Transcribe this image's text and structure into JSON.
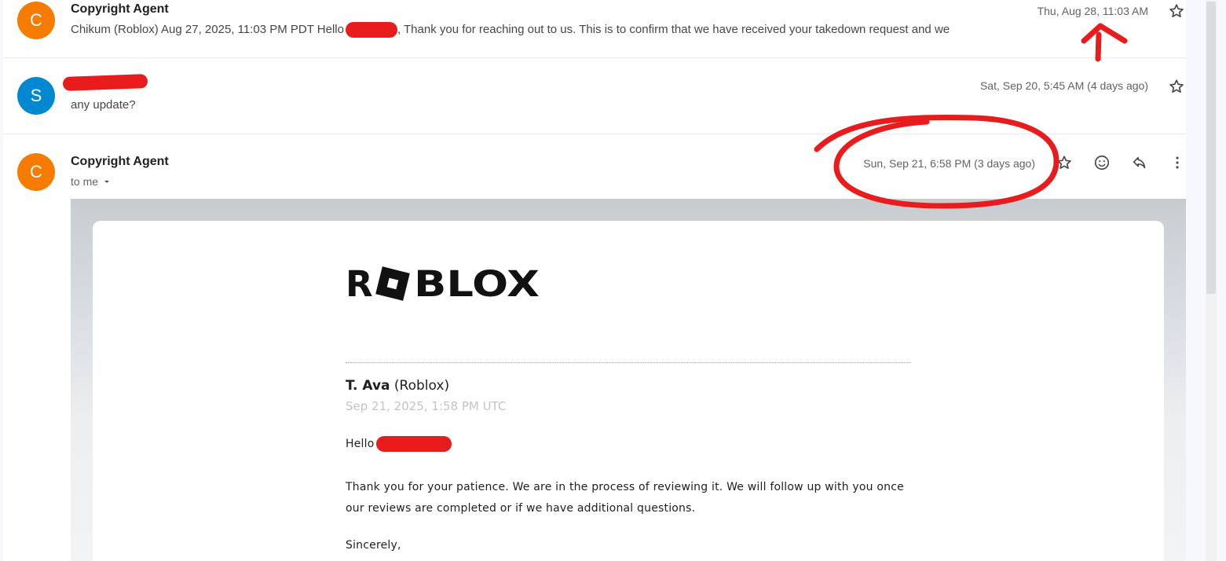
{
  "thread": [
    {
      "avatar_letter": "C",
      "avatar_color": "#f57c00",
      "sender": "Copyright Agent",
      "snippet_before": "Chikum (Roblox) Aug 27, 2025, 11:03 PM PDT Hello",
      "snippet_after": ", Thank you for reaching out to us. This is to confirm that we have received your takedown request and we",
      "date": "Thu, Aug 28, 11:03 AM"
    },
    {
      "avatar_letter": "S",
      "avatar_color": "#0288d1",
      "sender": "",
      "snippet": "any update?",
      "date": "Sat, Sep 20, 5:45 AM (4 days ago)"
    },
    {
      "avatar_letter": "C",
      "avatar_color": "#f57c00",
      "sender": "Copyright Agent",
      "recipient": "to me",
      "date": "Sun, Sep 21, 6:58 PM (3 days ago)"
    }
  ],
  "icons": {
    "star": "star-icon",
    "emoji": "emoji-icon",
    "reply": "reply-icon",
    "more": "more-vert-icon",
    "dropdown": "chevron-down-icon"
  },
  "email": {
    "brand_logo_text": "ROBLOX",
    "author_name": "T. Ava",
    "author_org": "(Roblox)",
    "timestamp": "Sep 21, 2025, 1:58 PM UTC",
    "greeting": "Hello",
    "paragraph_line1": "Thank you for your patience. We are in the process of reviewing it. We will follow up with you once",
    "paragraph_line2": "our reviews are completed or if we have additional questions.",
    "signoff": "Sincerely,"
  },
  "colors": {
    "annotation_red": "#e81c1c"
  }
}
